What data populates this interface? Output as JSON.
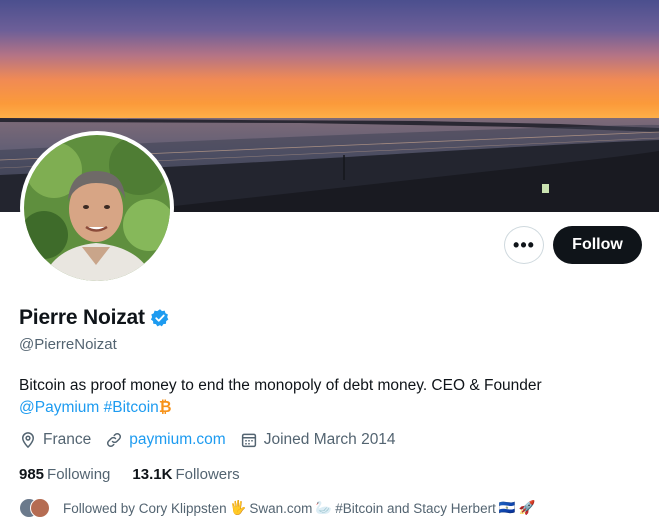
{
  "profile": {
    "name": "Pierre Noizat",
    "handle": "@PierreNoizat",
    "verified": true,
    "bio_text": "Bitcoin as proof money to end the monopoly of debt money. CEO & Founder",
    "bio_mention": "@Paymium",
    "bio_hashtag": "#Bitcoin",
    "bio_emoji": "₿",
    "location": "France",
    "website": "paymium.com",
    "joined": "Joined March 2014"
  },
  "actions": {
    "more_label": "•••",
    "follow_label": "Follow"
  },
  "stats": {
    "following_count": "985",
    "following_label": "Following",
    "followers_count": "13.1K",
    "followers_label": "Followers"
  },
  "followed_by": {
    "prefix": "Followed by Cory Klippsten",
    "emoji1": "🖐",
    "name2": "Swan.com",
    "emoji2": "🦢",
    "tail": "#Bitcoin and Stacy Herbert",
    "emoji3": "🇸🇻",
    "emoji4": "🚀"
  },
  "colors": {
    "accent": "#1d9bf0",
    "text": "#0f1419",
    "muted": "#536471",
    "bitcoin": "#f7931a"
  },
  "icons": {
    "location": "map-pin-icon",
    "website": "link-icon",
    "joined": "calendar-icon",
    "verified": "verified-badge-icon"
  }
}
